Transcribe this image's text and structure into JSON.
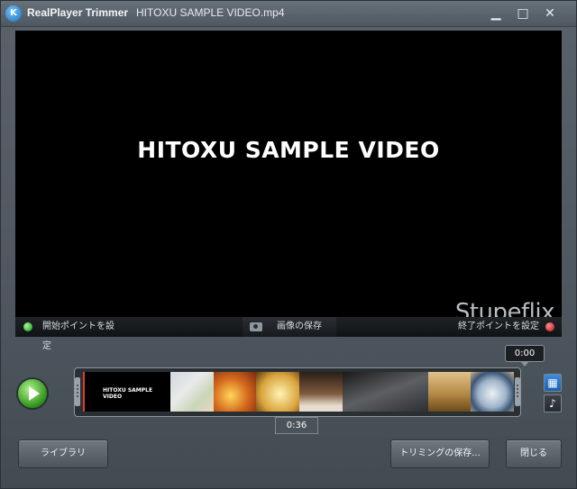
{
  "titlebar": {
    "app_logo": "K",
    "app_title": "RealPlayer Trimmer",
    "file_title": "HITOXU SAMPLE VIDEO.mp4",
    "minimize": "▁",
    "maximize": "□",
    "close": "✕"
  },
  "video": {
    "title_text": "HITOXU SAMPLE VIDEO",
    "watermark": "Stupeflix"
  },
  "controls": {
    "set_start": "開始ポイントを設定",
    "save_image": "画像の保存",
    "set_end": "終了ポイントを設定"
  },
  "timeline": {
    "current_time": "0:00",
    "duration": "0:36",
    "first_thumb_text": "HITOXU SAMPLE VIDEO"
  },
  "side": {
    "video_icon": "▦",
    "audio_icon": "♪"
  },
  "buttons": {
    "library": "ライブラリ",
    "save_trim": "トリミングの保存...",
    "close": "閉じる"
  }
}
